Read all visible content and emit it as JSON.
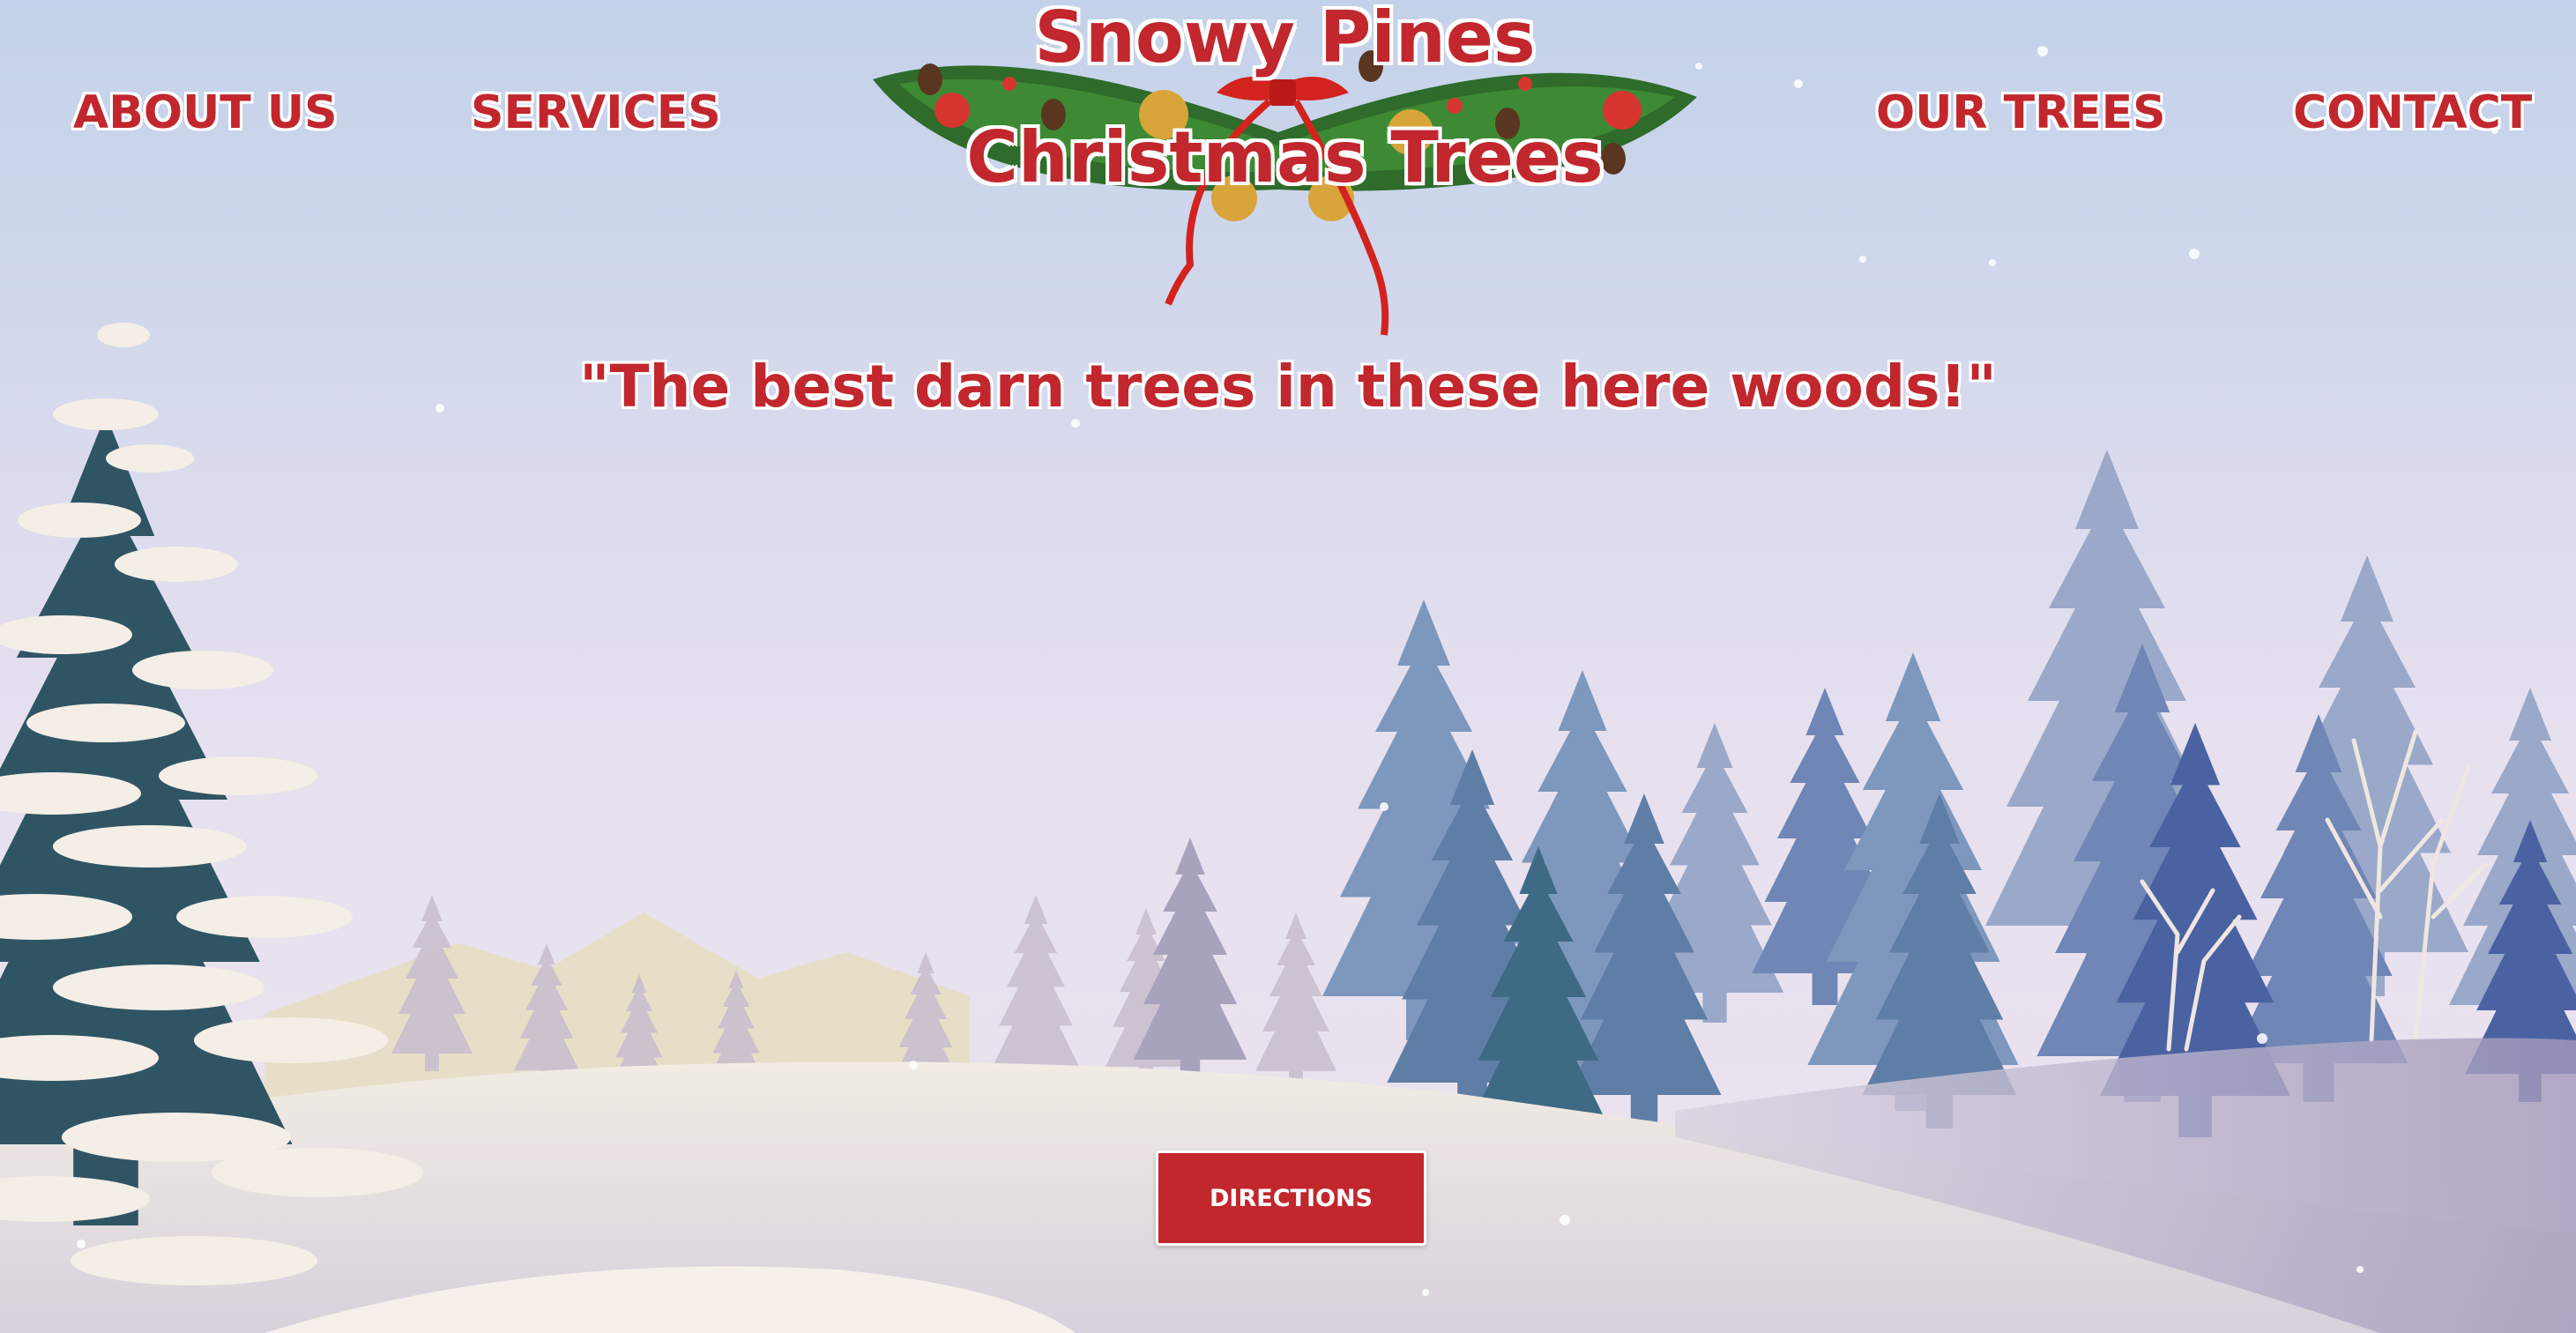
{
  "nav": {
    "about": "ABOUT US",
    "services": "SERVICES",
    "trees": "OUR TREES",
    "contact": "CONTACT"
  },
  "logo": {
    "line1": "Snowy Pines",
    "line2": "Christmas Trees"
  },
  "hero": {
    "tagline": "\"The best darn trees in these here woods!\"",
    "button_label": "DIRECTIONS"
  },
  "colors": {
    "brand_red": "#c1272d",
    "sky_top": "#c3d2ea",
    "sky_bottom": "#ebe2ef",
    "snow": "#f0ebe4"
  }
}
